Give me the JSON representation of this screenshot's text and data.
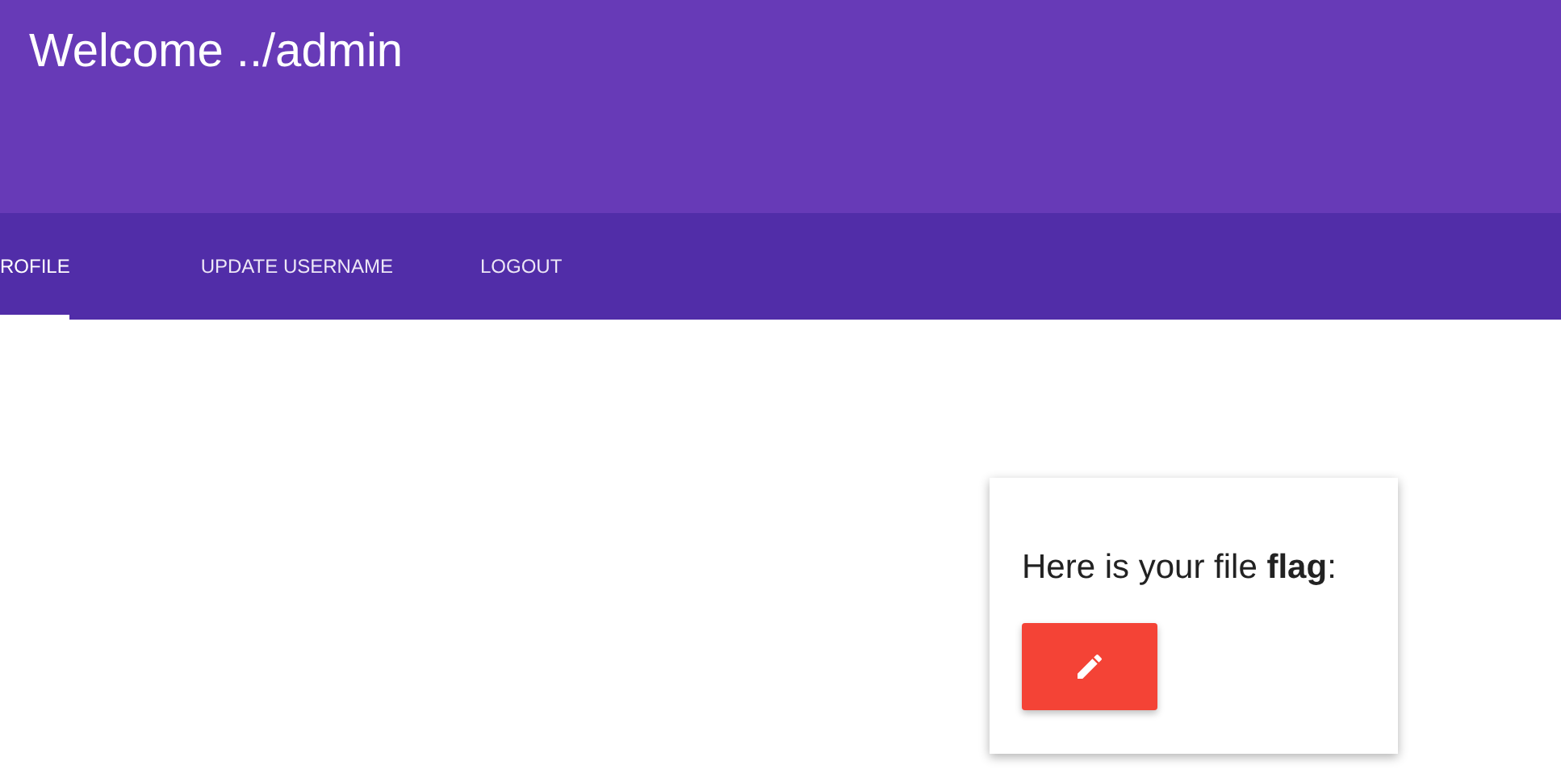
{
  "header": {
    "title": "Welcome ../admin"
  },
  "tabs": [
    {
      "label": "ROFILE",
      "selected": true
    },
    {
      "label": "UPDATE USERNAME",
      "selected": false
    },
    {
      "label": "LOGOUT",
      "selected": false
    }
  ],
  "card": {
    "text": "Here is your file **flag**:"
  }
}
